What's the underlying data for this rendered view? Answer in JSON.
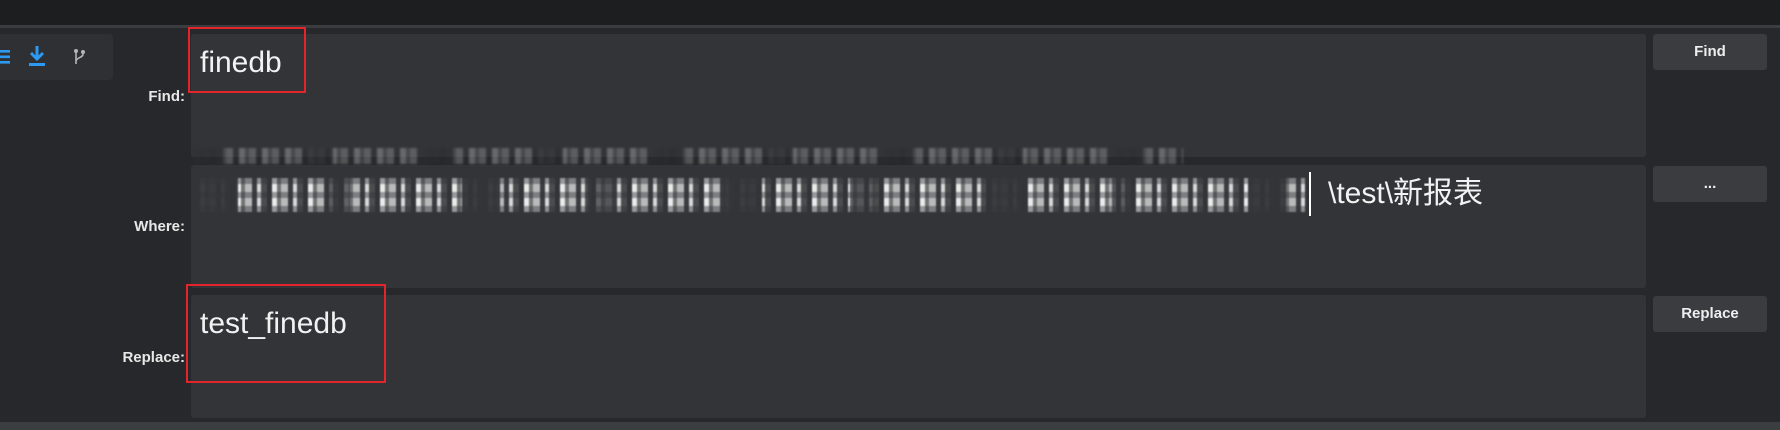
{
  "toolbar": {
    "icons": [
      "list-icon",
      "download-icon",
      "branch-icon"
    ]
  },
  "labels": {
    "find": "Find:",
    "where": "Where:",
    "replace": "Replace:"
  },
  "fields": {
    "find_value": "finedb",
    "where_value": "\\test\\新报表",
    "replace_value": "test_finedb"
  },
  "buttons": {
    "find": "Find",
    "browse": "...",
    "replace": "Replace"
  },
  "colors": {
    "accent": "#2b9af3",
    "highlight_box": "#e3242b",
    "panel": "#26282b",
    "field": "#323438",
    "button": "#3a3c40"
  }
}
